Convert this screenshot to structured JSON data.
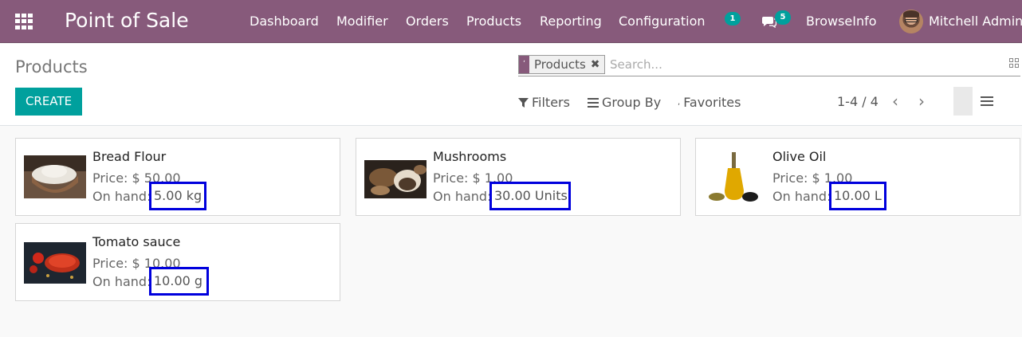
{
  "navbar": {
    "brand": "Point of Sale",
    "menu": [
      "Dashboard",
      "Modifier",
      "Orders",
      "Products",
      "Reporting",
      "Configuration"
    ],
    "activity_badge": "1",
    "messages_badge": "5",
    "company": "BrowseInfo",
    "user": "Mitchell Admin"
  },
  "control_panel": {
    "title": "Products",
    "search": {
      "facet_value": "Products",
      "placeholder": "Search..."
    },
    "create_label": "CREATE",
    "filters_label": "Filters",
    "group_by_label": "Group By",
    "favorites_label": "Favorites",
    "pager": "1-4 / 4"
  },
  "products": [
    {
      "name": "Bread Flour",
      "price": "Price: $ 50.00",
      "onhand_label": "On hand:",
      "qty": "5.00 kg",
      "image": "flour-bowl"
    },
    {
      "name": "Mushrooms",
      "price": "Price: $ 1.00",
      "onhand_label": "On hand:",
      "qty": "30.00 Units",
      "image": "mushrooms"
    },
    {
      "name": "Olive Oil",
      "price": "Price: $ 1.00",
      "onhand_label": "On hand:",
      "qty": "10.00 L",
      "image": "olive-oil-bottle"
    },
    {
      "name": "Tomato sauce",
      "price": "Price: $ 10.00",
      "onhand_label": "On hand:",
      "qty": "10.00 g",
      "image": "tomato-sauce"
    }
  ],
  "colors": {
    "navbar": "#875a7b",
    "primary": "#00a09d",
    "highlight": "#0000dd"
  }
}
